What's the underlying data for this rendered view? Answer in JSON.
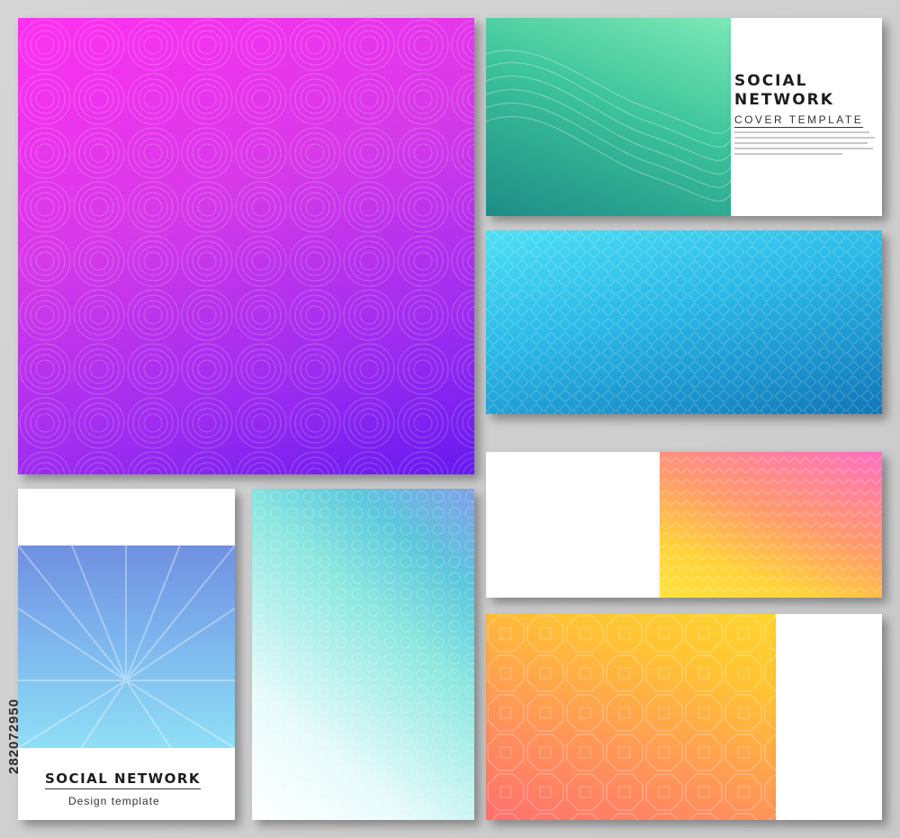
{
  "cover_green": {
    "title_line1": "SOCIAL",
    "title_line2": "NETWORK",
    "subtitle": "COVER TEMPLATE"
  },
  "cover_portrait": {
    "title": "SOCIAL NETWORK",
    "subtitle": "Design template"
  },
  "stock_id": "282072950",
  "colors": {
    "magenta": "#ff30f0",
    "violet": "#6419f0",
    "green": "#3cc49a",
    "blue": "#2ab7e6",
    "orange": "#ff9a55",
    "yellow": "#ffd530",
    "pink": "#ff6fc0",
    "teal": "#5cc8dc"
  }
}
